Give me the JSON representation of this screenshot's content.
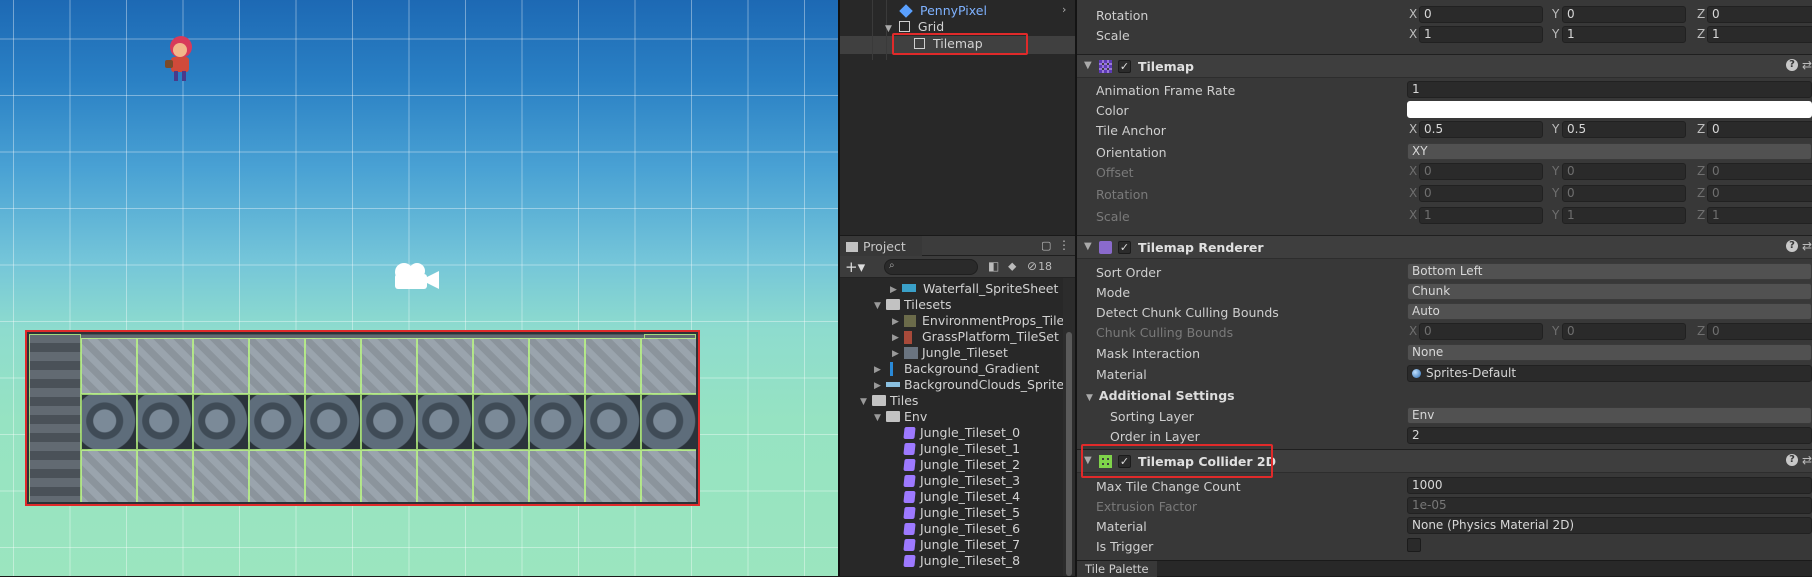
{
  "hierarchy": {
    "items": [
      {
        "label": "PennyPixel",
        "color": "#7fb2ff"
      },
      {
        "label": "Grid"
      },
      {
        "label": "Tilemap",
        "selected": true
      }
    ]
  },
  "project": {
    "tab": "Project",
    "search_placeholder": "",
    "hidden_count": "18",
    "items": [
      {
        "label": "Waterfall_SpriteSheet"
      },
      {
        "label": "Tilesets"
      },
      {
        "label": "EnvironmentProps_TileSet"
      },
      {
        "label": "GrassPlatform_TileSet"
      },
      {
        "label": "Jungle_Tileset"
      },
      {
        "label": "Background_Gradient"
      },
      {
        "label": "BackgroundClouds_SpriteSh"
      },
      {
        "label": "Tiles"
      },
      {
        "label": "Env"
      },
      {
        "label": "Jungle_Tileset_0"
      },
      {
        "label": "Jungle_Tileset_1"
      },
      {
        "label": "Jungle_Tileset_2"
      },
      {
        "label": "Jungle_Tileset_3"
      },
      {
        "label": "Jungle_Tileset_4"
      },
      {
        "label": "Jungle_Tileset_5"
      },
      {
        "label": "Jungle_Tileset_6"
      },
      {
        "label": "Jungle_Tileset_7"
      },
      {
        "label": "Jungle_Tileset_8"
      }
    ]
  },
  "inspector": {
    "transform": {
      "rotation_label": "Rotation",
      "rotation": [
        "0",
        "0",
        "0"
      ],
      "scale_label": "Scale",
      "scale": [
        "1",
        "1",
        "1"
      ]
    },
    "tilemap": {
      "title": "Tilemap",
      "animation_frame_rate_label": "Animation Frame Rate",
      "animation_frame_rate": "1",
      "color_label": "Color",
      "color": "#ffffff",
      "tile_anchor_label": "Tile Anchor",
      "tile_anchor": [
        "0.5",
        "0.5",
        "0"
      ],
      "orientation_label": "Orientation",
      "orientation": "XY",
      "offset_label": "Offset",
      "offset": [
        "0",
        "0",
        "0"
      ],
      "rotation_label": "Rotation",
      "rotation": [
        "0",
        "0",
        "0"
      ],
      "scale_label": "Scale",
      "scale": [
        "1",
        "1",
        "1"
      ]
    },
    "renderer": {
      "title": "Tilemap Renderer",
      "sort_order_label": "Sort Order",
      "sort_order": "Bottom Left",
      "mode_label": "Mode",
      "mode": "Chunk",
      "detect_label": "Detect Chunk Culling Bounds",
      "detect": "Auto",
      "chunk_bounds_label": "Chunk Culling Bounds",
      "chunk_bounds": [
        "0",
        "0",
        "0"
      ],
      "mask_label": "Mask Interaction",
      "mask": "None",
      "material_label": "Material",
      "material": "Sprites-Default",
      "additional_label": "Additional Settings",
      "sorting_layer_label": "Sorting Layer",
      "sorting_layer": "Env",
      "order_label": "Order in Layer",
      "order": "2"
    },
    "collider": {
      "title": "Tilemap Collider 2D",
      "max_label": "Max Tile Change Count",
      "max": "1000",
      "extrusion_label": "Extrusion Factor",
      "extrusion": "1e-05",
      "material_label": "Material",
      "material": "None (Physics Material 2D)",
      "trigger_label": "Is Trigger"
    },
    "axes": [
      "X",
      "Y",
      "Z"
    ]
  },
  "tile_palette_tab": "Tile Palette",
  "colors": {
    "selection_outline": "#e02a2a",
    "scene_sky_top": "#1d69b4",
    "scene_sky_bottom": "#9be5bf"
  }
}
